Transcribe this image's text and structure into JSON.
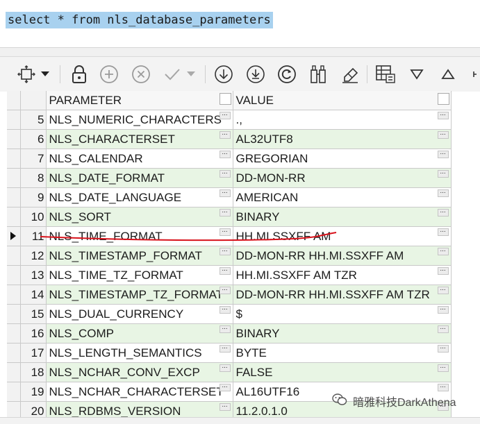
{
  "editor": {
    "sql": "select * from nls_database_parameters"
  },
  "toolbar": {
    "icons": [
      "grid-layout-icon",
      "dropdown-arrow-icon",
      "lock-icon",
      "add-icon",
      "delete-icon",
      "commit-check-icon",
      "commit-dropdown-icon",
      "fetch-next-icon",
      "fetch-all-icon",
      "refresh-icon",
      "filter-value-icon",
      "clear-icon",
      "columns-icon",
      "sort-descending-icon",
      "sort-ascending-icon"
    ]
  },
  "grid": {
    "columns": [
      "PARAMETER",
      "VALUE"
    ],
    "current_row": "11",
    "rows": [
      {
        "num": "5",
        "parameter": "NLS_NUMERIC_CHARACTERS",
        "value": ".,"
      },
      {
        "num": "6",
        "parameter": "NLS_CHARACTERSET",
        "value": "AL32UTF8"
      },
      {
        "num": "7",
        "parameter": "NLS_CALENDAR",
        "value": "GREGORIAN"
      },
      {
        "num": "8",
        "parameter": "NLS_DATE_FORMAT",
        "value": "DD-MON-RR"
      },
      {
        "num": "9",
        "parameter": "NLS_DATE_LANGUAGE",
        "value": "AMERICAN"
      },
      {
        "num": "10",
        "parameter": "NLS_SORT",
        "value": "BINARY"
      },
      {
        "num": "11",
        "parameter": "NLS_TIME_FORMAT",
        "value": "HH.MI.SSXFF AM"
      },
      {
        "num": "12",
        "parameter": "NLS_TIMESTAMP_FORMAT",
        "value": "DD-MON-RR HH.MI.SSXFF AM"
      },
      {
        "num": "13",
        "parameter": "NLS_TIME_TZ_FORMAT",
        "value": "HH.MI.SSXFF AM TZR"
      },
      {
        "num": "14",
        "parameter": "NLS_TIMESTAMP_TZ_FORMAT",
        "value": "DD-MON-RR HH.MI.SSXFF AM TZR"
      },
      {
        "num": "15",
        "parameter": "NLS_DUAL_CURRENCY",
        "value": "$"
      },
      {
        "num": "16",
        "parameter": "NLS_COMP",
        "value": "BINARY"
      },
      {
        "num": "17",
        "parameter": "NLS_LENGTH_SEMANTICS",
        "value": "BYTE"
      },
      {
        "num": "18",
        "parameter": "NLS_NCHAR_CONV_EXCP",
        "value": "FALSE"
      },
      {
        "num": "19",
        "parameter": "NLS_NCHAR_CHARACTERSET",
        "value": "AL16UTF16"
      },
      {
        "num": "20",
        "parameter": "NLS_RDBMS_VERSION",
        "value": "11.2.0.1.0"
      }
    ]
  },
  "watermark": {
    "text": "暗雅科技DarkAthena"
  },
  "colors": {
    "selection": "#a8d1ef",
    "alt_row": "#e8f5e4",
    "annotation": "#d8121b"
  }
}
